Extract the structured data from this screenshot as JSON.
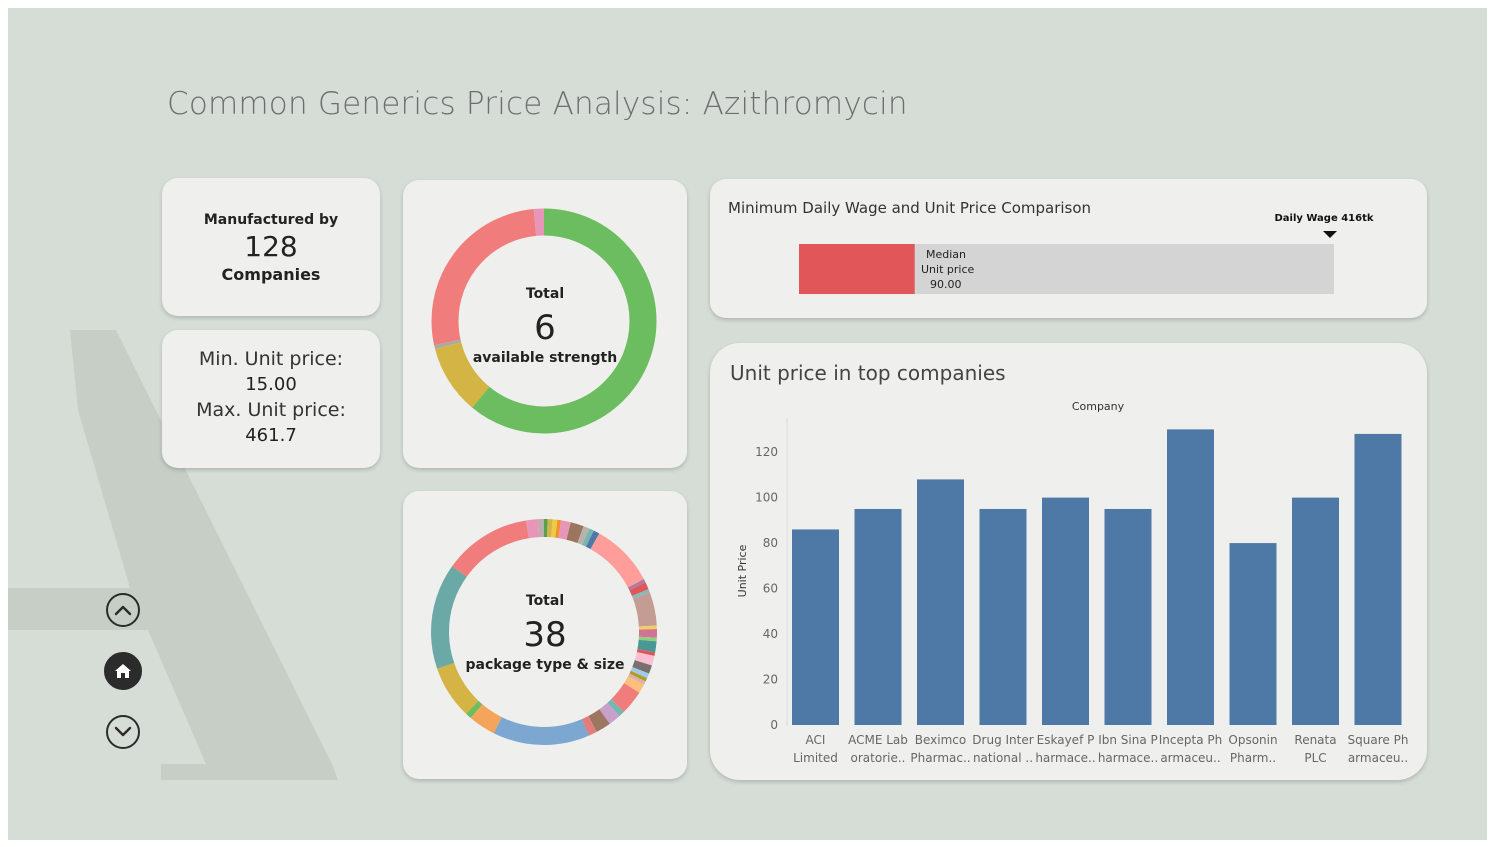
{
  "title": "Common Generics Price Analysis: Azithromycin",
  "companies_card": {
    "line1": "Manufactured by",
    "count": "128",
    "line2": "Companies"
  },
  "price_card": {
    "min_label": "Min. Unit price:",
    "min_value": "15.00",
    "max_label": "Max. Unit price:",
    "max_value": "461.7"
  },
  "strength_card": {
    "total_label": "Total",
    "count": "6",
    "sub_label": "available strength"
  },
  "package_card": {
    "total_label": "Total",
    "count": "38",
    "sub_label": "package type & size"
  },
  "wage_card": {
    "title": "Minimum Daily Wage and Unit Price Comparison",
    "wage_label": "Daily Wage 416tk",
    "median_line1": "Median",
    "median_line2": "Unit price",
    "median_value": "90.00"
  },
  "nav": {
    "up_icon": "chevron-up-icon",
    "home_icon": "home-icon",
    "down_icon": "chevron-down-icon"
  },
  "colors": {
    "bar": "#4e79a7",
    "median": "#e15759",
    "wage_track": "#d4d4d4",
    "background": "#d6ddd6",
    "card": "#eff0ed"
  },
  "chart_data": [
    {
      "type": "pie",
      "variant": "donut",
      "name": "available strength",
      "colors": [
        "#6bbd5f",
        "#d4b444",
        "#a9a9a9",
        "#f07c7c",
        "#e896b8"
      ],
      "values": [
        61,
        10,
        0.5,
        27,
        1.5
      ]
    },
    {
      "type": "pie",
      "variant": "donut",
      "name": "package type & size",
      "colors": [
        "#59a14f",
        "#d4b444",
        "#edc948",
        "#f28e2b",
        "#e896b8",
        "#9c755f",
        "#bab0ac",
        "#76b7b2",
        "#4e79a7",
        "#ff9d9a",
        "#b07aa1",
        "#e15759",
        "#86bcb6",
        "#c49c94",
        "#f1ce63",
        "#d37295",
        "#8cd17d",
        "#499894",
        "#e15759",
        "#fabfd2",
        "#79706e",
        "#a0cbe8",
        "#b6992d",
        "#d7b5a6",
        "#ffbe7d",
        "#f07c7c",
        "#76b7b2",
        "#c7a0cb",
        "#9d7660",
        "#e17d7d",
        "#7ba7d1",
        "#f5a55b",
        "#6bbd5f",
        "#d4b444",
        "#6aa9a5",
        "#f07c7c",
        "#e896b8",
        "#bab0ac"
      ],
      "values": [
        0.6,
        0.8,
        0.8,
        0.6,
        1.6,
        2.2,
        1.0,
        0.8,
        1.0,
        10.5,
        0.6,
        1.2,
        0.6,
        5.5,
        0.6,
        1.4,
        0.6,
        1.8,
        0.6,
        1.6,
        1.4,
        0.8,
        0.6,
        0.6,
        1.5,
        4.0,
        1.0,
        2.0,
        2.5,
        1.4,
        16.0,
        4.5,
        1.0,
        8.8,
        17.5,
        14.5,
        2.0,
        1.0
      ]
    },
    {
      "type": "bar",
      "name": "Minimum Daily Wage and Unit Price Comparison",
      "values": {
        "median_unit_price": 90,
        "daily_wage": 416
      },
      "xlim": [
        0,
        416
      ]
    },
    {
      "type": "bar",
      "title": "Unit price in top companies",
      "xlabel": "Company",
      "ylabel": "Unit Price",
      "categories": [
        [
          "ACI",
          "Limited"
        ],
        [
          "ACME Lab",
          "oratorie.."
        ],
        [
          "Beximco",
          "Pharmac.."
        ],
        [
          "Drug Inter",
          "national .."
        ],
        [
          "Eskayef P",
          "harmace.."
        ],
        [
          "Ibn Sina P",
          "harmace.."
        ],
        [
          "Incepta Ph",
          "armaceu.."
        ],
        [
          "Opsonin",
          "Pharm.."
        ],
        [
          "Renata",
          "PLC"
        ],
        [
          "Square Ph",
          "armaceu.."
        ]
      ],
      "values": [
        86,
        95,
        108,
        95,
        100,
        95,
        130,
        80,
        100,
        128
      ],
      "ylim": [
        0,
        135
      ],
      "yticks": [
        0,
        20,
        40,
        60,
        80,
        100,
        120
      ],
      "grid": false
    }
  ]
}
